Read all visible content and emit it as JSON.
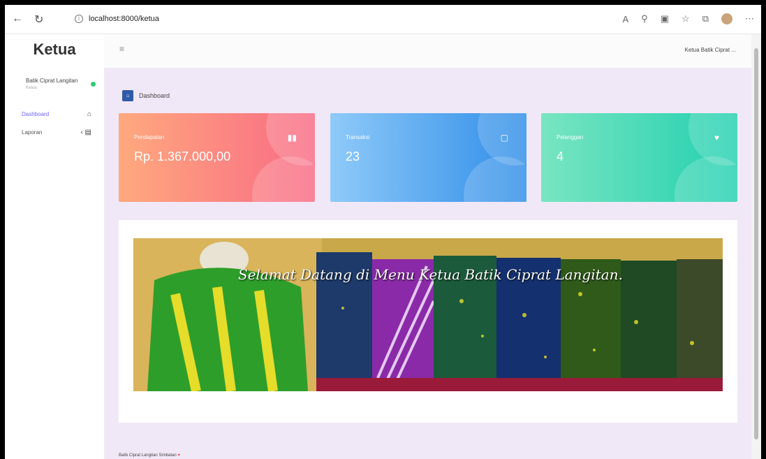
{
  "browser": {
    "url": "localhost:8000/ketua",
    "back_icon": "←",
    "reload_icon": "↻"
  },
  "sidebar": {
    "brand": "Ketua",
    "profile_name": "Batik Ciprat Langitan",
    "profile_role": "Ketua",
    "items": [
      {
        "label": "Dashboard",
        "icon": "home-icon"
      },
      {
        "label": "Laporan",
        "icon": "report-icon"
      }
    ]
  },
  "topbar": {
    "user": "Ketua Batik Ciprat ..."
  },
  "page": {
    "title": "Dashboard"
  },
  "cards": [
    {
      "label": "Pendapatan",
      "value": "Rp. 1.367.000,00",
      "icon": "chart-icon"
    },
    {
      "label": "Transaksi",
      "value": "23",
      "icon": "cart-icon"
    },
    {
      "label": "Pelanggan",
      "value": "4",
      "icon": "heart-icon"
    }
  ],
  "banner": {
    "welcome": "Selamat Datang di Menu Ketua Batik Ciprat Langitan."
  },
  "footer": {
    "text": "Batik Ciprat Langitan Simbatan",
    "heart": "♥"
  }
}
